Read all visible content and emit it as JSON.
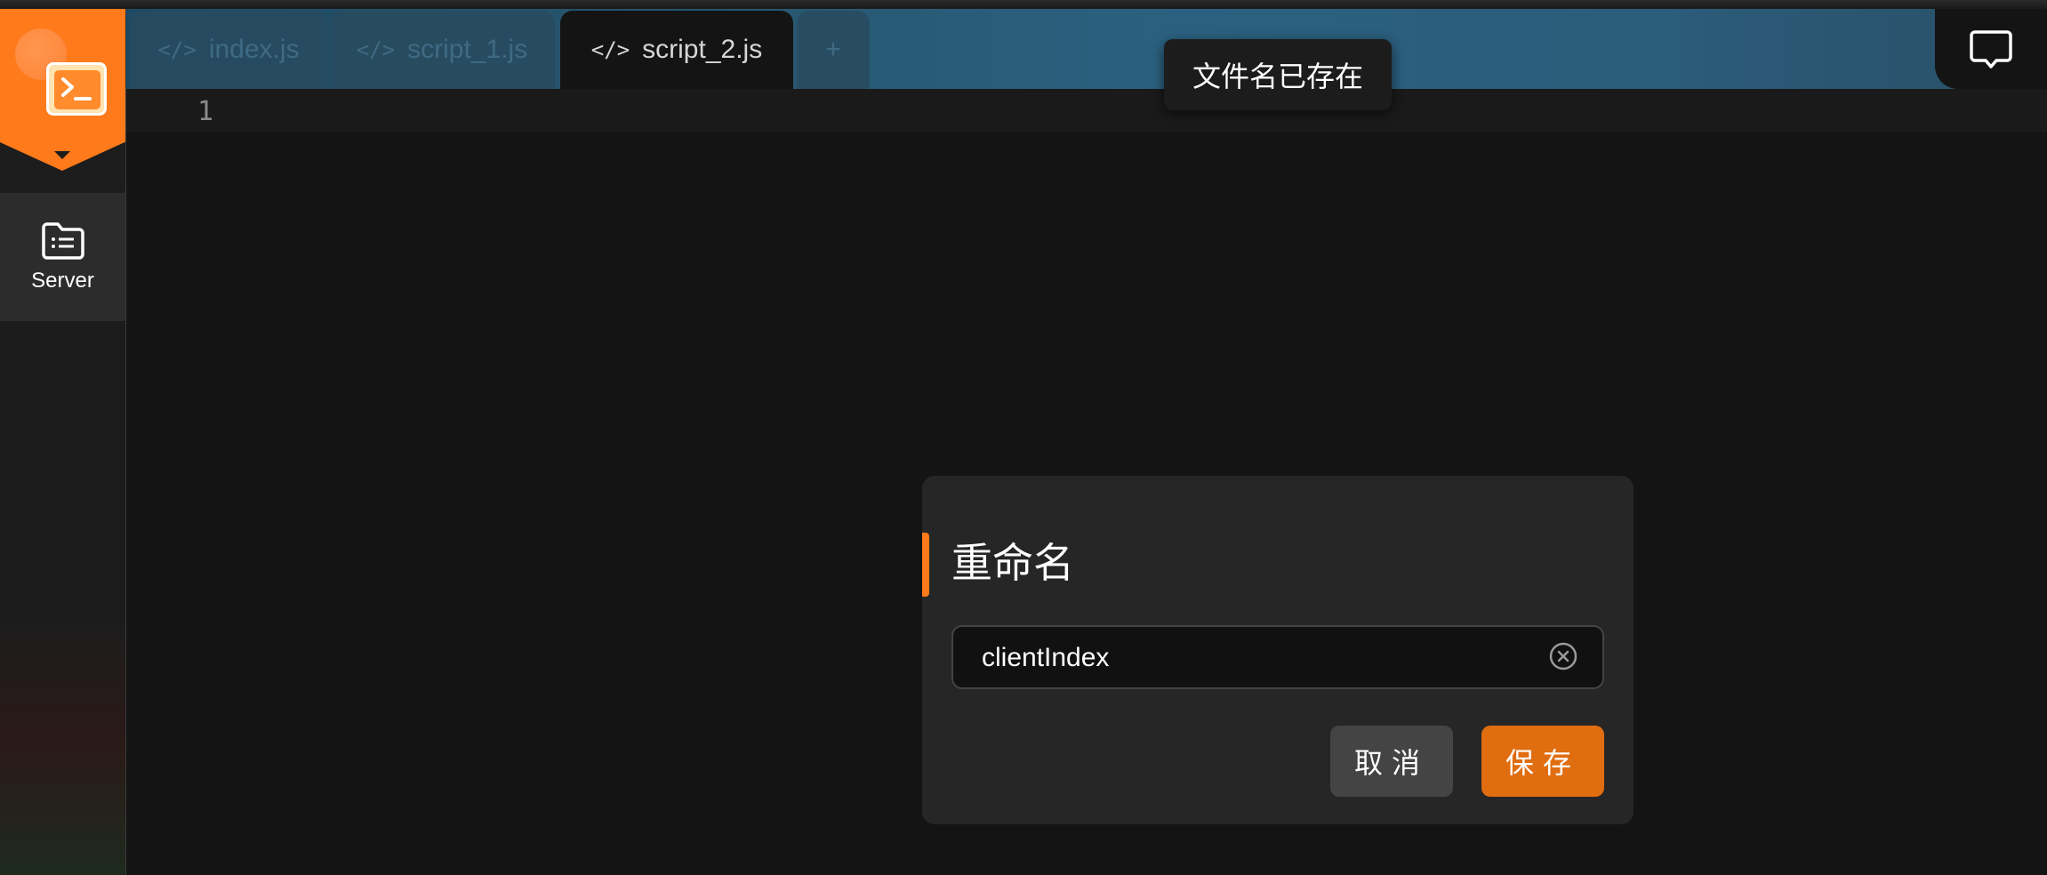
{
  "sidebar": {
    "items": [
      {
        "label": "Server",
        "icon": "folder-list-icon"
      }
    ]
  },
  "tabs": [
    {
      "label": "index.js",
      "icon": "code-icon",
      "active": false
    },
    {
      "label": "script_1.js",
      "icon": "code-icon",
      "active": false
    },
    {
      "label": "script_2.js",
      "icon": "code-icon",
      "active": true
    }
  ],
  "tab_add_label": "+",
  "tab_icon_glyph": "</>",
  "editor": {
    "line_numbers": [
      "1"
    ]
  },
  "toast": {
    "message": "文件名已存在"
  },
  "rename_dialog": {
    "title": "重命名",
    "input_value": "clientIndex",
    "cancel_label": "取消",
    "save_label": "保存"
  },
  "colors": {
    "accent": "#ff7a1a",
    "save_button": "#e06d10",
    "cancel_button": "#444444",
    "editor_bg": "#141414"
  }
}
